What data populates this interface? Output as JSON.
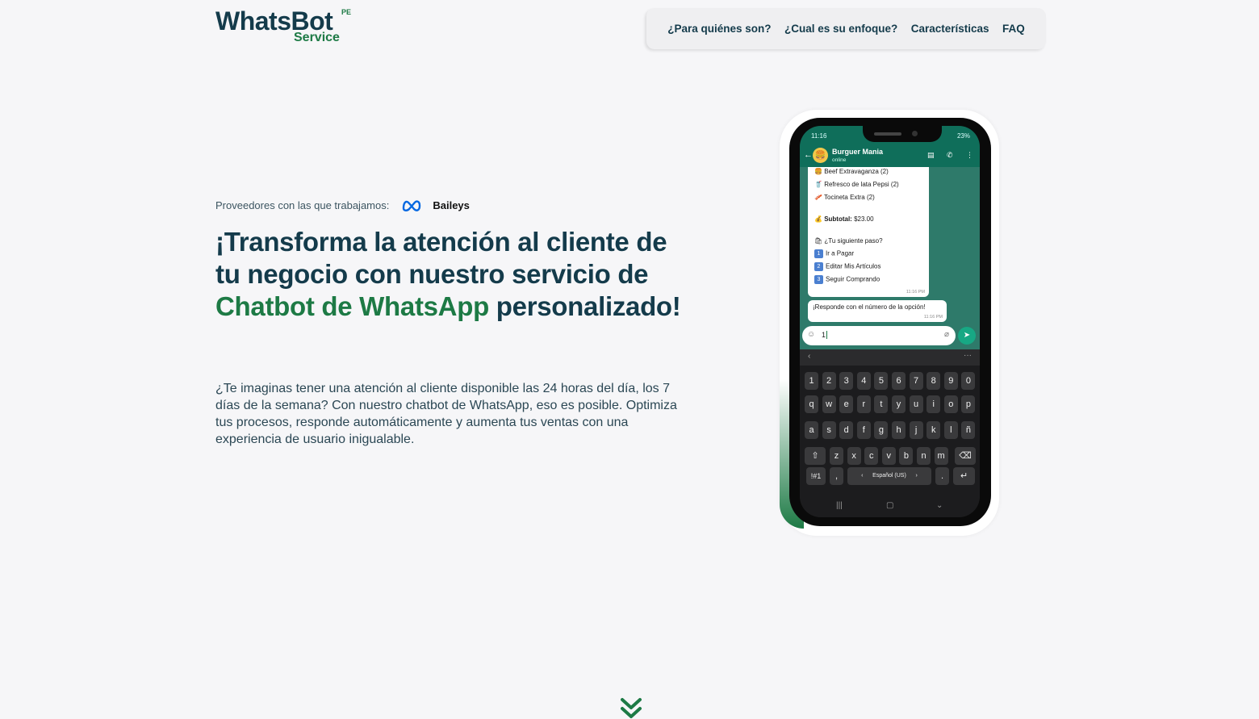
{
  "header": {
    "logo_main": "WhatsBot",
    "logo_sup": "PE",
    "logo_sub": "Service",
    "nav": [
      {
        "label": "¿Para quiénes son?"
      },
      {
        "label": "¿Cual es su enfoque?"
      },
      {
        "label": "Características"
      },
      {
        "label": "FAQ"
      }
    ]
  },
  "hero": {
    "providers_label": "Proveedores con las que trabajamos:",
    "provider_name": "Baileys",
    "headline_part1": "¡Transforma la atención al cliente de tu negocio con nuestro servicio de ",
    "headline_green": "Chatbot de WhatsApp",
    "headline_part2": " personalizado!",
    "description": "¿Te imaginas tener una atención al cliente disponible las 24 horas del día, los 7 días de la semana? Con nuestro chatbot de WhatsApp, eso es posible. Optimiza tus procesos, responde automáticamente y aumenta tus ventas con una experiencia de usuario inigualable."
  },
  "phone": {
    "time": "11:16",
    "status_right": "23%",
    "chat_name": "Burguer Mania",
    "chat_status": "online",
    "items": [
      "Beef Extravaganza  (2)",
      "Refresco de lata Pepsi  (2)",
      "Tocineta Extra (2)"
    ],
    "subtotal_label": "Subtotal:",
    "subtotal_value": "$23.00",
    "next_step": "¿Tu siguiente paso?",
    "options": [
      {
        "num": "1",
        "label": "Ir a Pagar"
      },
      {
        "num": "2",
        "label": "Editar Mis Artículos"
      },
      {
        "num": "3",
        "label": "Seguir Comprando"
      }
    ],
    "msg_time": "11:16 PM",
    "msg2": "¡Responde con el número de la opción!",
    "input_value": "1",
    "kb_rows": [
      [
        "1",
        "2",
        "3",
        "4",
        "5",
        "6",
        "7",
        "8",
        "9",
        "0"
      ],
      [
        "q",
        "w",
        "e",
        "r",
        "t",
        "y",
        "u",
        "i",
        "o",
        "p"
      ],
      [
        "a",
        "s",
        "d",
        "f",
        "g",
        "h",
        "j",
        "k",
        "l",
        "ñ"
      ],
      [
        "⇧",
        "z",
        "x",
        "c",
        "v",
        "b",
        "n",
        "m",
        "⌫"
      ]
    ],
    "kb_sym": "!#1",
    "kb_comma": ",",
    "kb_lang": "Español (US)",
    "kb_dot": ".",
    "kb_enter": "↵"
  },
  "colors": {
    "navy": "#143b4b",
    "green": "#1d7a45",
    "wa_header": "#0f6e5a"
  }
}
